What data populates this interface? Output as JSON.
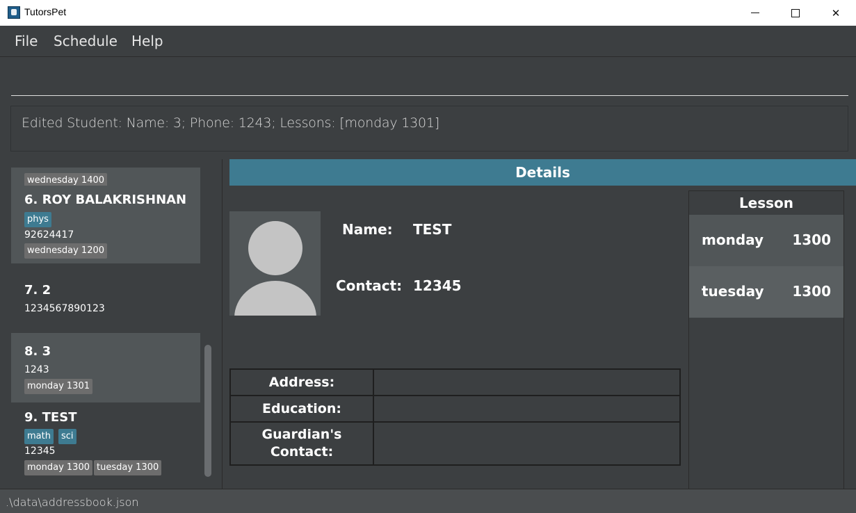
{
  "window": {
    "title": "TutorsPet"
  },
  "menu": {
    "file": "File",
    "schedule": "Schedule",
    "help": "Help"
  },
  "command": {
    "value": ""
  },
  "result": {
    "text": "Edited Student: Name: 3; Phone: 1243; Lessons: [monday 1301]"
  },
  "students": [
    {
      "partial_lesson": "wednesday 1400"
    },
    {
      "index": "6.",
      "name": "ROY BALAKRISHNAN",
      "subjects": [
        "phys"
      ],
      "phone": "92624417",
      "lessons": [
        "wednesday 1200"
      ]
    },
    {
      "index": "7.",
      "name": "2",
      "subjects": [],
      "phone": "1234567890123",
      "lessons": []
    },
    {
      "index": "8.",
      "name": "3",
      "subjects": [],
      "phone": "1243",
      "lessons": [
        "monday 1301"
      ]
    },
    {
      "index": "9.",
      "name": "TEST",
      "subjects": [
        "math",
        "sci"
      ],
      "phone": "12345",
      "lessons": [
        "monday 1300",
        "tuesday 1300"
      ]
    }
  ],
  "details": {
    "header": "Details",
    "name_label": "Name:",
    "name_value": "TEST",
    "contact_label": "Contact:",
    "contact_value": "12345",
    "address_label": "Address:",
    "address_value": "",
    "education_label": "Education:",
    "education_value": "",
    "guardian_label_line1": "Guardian's",
    "guardian_label_line2": "Contact:",
    "guardian_value": ""
  },
  "lessons": {
    "title": "Lesson",
    "items": [
      {
        "day": "monday",
        "time": "1300"
      },
      {
        "day": "tuesday",
        "time": "1300"
      }
    ]
  },
  "status": {
    "path": ".\\data\\addressbook.json"
  }
}
